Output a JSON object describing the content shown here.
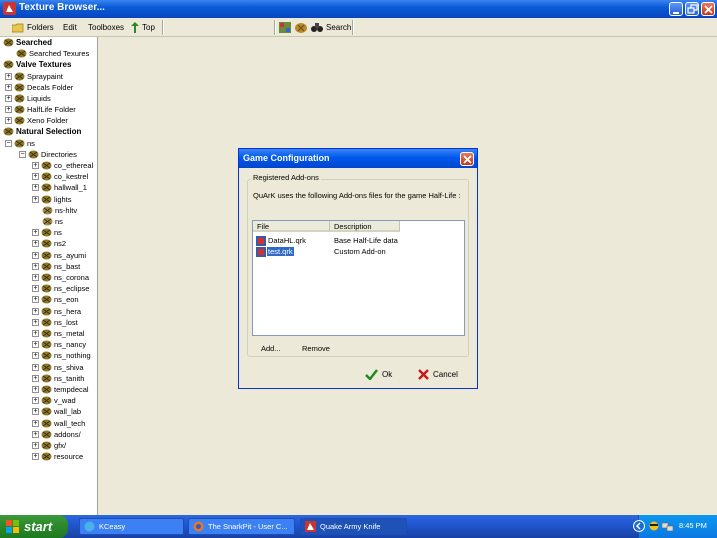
{
  "window": {
    "title": "Texture Browser..."
  },
  "toolbar": {
    "folders": "Folders",
    "edit": "Edit",
    "toolboxes": "Toolboxes",
    "top": "Top",
    "search": "Search"
  },
  "tree": {
    "searched": "Searched",
    "searched_textures": "Searched Texures",
    "valve_textures": "Valve Textures",
    "spraypaint": "Spraypaint",
    "decals": "Decals Folder",
    "liquids": "Liquids",
    "halflife": "HalfLife Folder",
    "xeno": "Xeno Folder",
    "natural_selection": "Natural Selection",
    "ns": "ns",
    "directories": "Directories",
    "dirs": [
      "co_ethereal",
      "co_kestrel",
      "hallwall_1",
      "lights",
      "ns-hltv",
      "ns",
      "ns",
      "ns2",
      "ns_ayumi",
      "ns_bast",
      "ns_corona",
      "ns_eclipse",
      "ns_eon",
      "ns_hera",
      "ns_lost",
      "ns_metal",
      "ns_nancy",
      "ns_nothing",
      "ns_shiva",
      "ns_tanith",
      "tempdecal",
      "v_wad",
      "wall_lab",
      "wall_tech",
      "addons/",
      "gfx/",
      "resource"
    ]
  },
  "dialog": {
    "title": "Game Configuration",
    "group_label": "Registered Add-ons",
    "description": "QuArK uses the following Add-ons files for the game Half-Life :",
    "columns": {
      "file": "File",
      "description": "Description"
    },
    "rows": [
      {
        "file": "DataHL.qrk",
        "description": "Base Half-Life data"
      },
      {
        "file": "test.qrk",
        "description": "Custom Add-on"
      }
    ],
    "add": "Add...",
    "remove": "Remove",
    "ok": "Ok",
    "cancel": "Cancel"
  },
  "taskbar": {
    "start": "start",
    "tasks": [
      "KCeasy",
      "The SnarkPit - User C...",
      "Quake Army Knife"
    ],
    "clock": "8:45 PM"
  },
  "colors": {
    "titlebar": "#0a5ad8",
    "selection": "#316ac5",
    "start": "#2e8b2e"
  }
}
